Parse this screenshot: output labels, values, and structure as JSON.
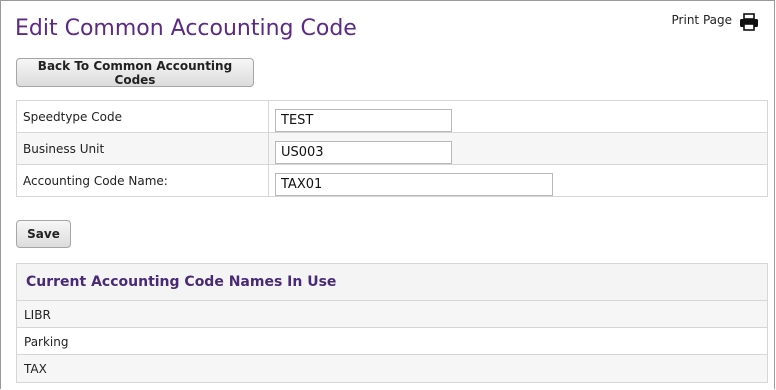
{
  "page": {
    "title": "Edit Common Accounting Code",
    "print_label": "Print Page",
    "print_icon": "printer-icon"
  },
  "actions": {
    "back_label": "Back To Common Accounting Codes",
    "save_label": "Save"
  },
  "form": {
    "fields": [
      {
        "label": "Speedtype Code",
        "value": "TEST"
      },
      {
        "label": "Business Unit",
        "value": "US003"
      },
      {
        "label": "Accounting Code Name:",
        "value": "TAX01"
      }
    ]
  },
  "names_in_use": {
    "heading": "Current Accounting Code Names In Use",
    "items": [
      "LIBR",
      "Parking",
      "TAX"
    ]
  },
  "colors": {
    "title": "#5a2a86",
    "heading": "#4a2a76"
  }
}
